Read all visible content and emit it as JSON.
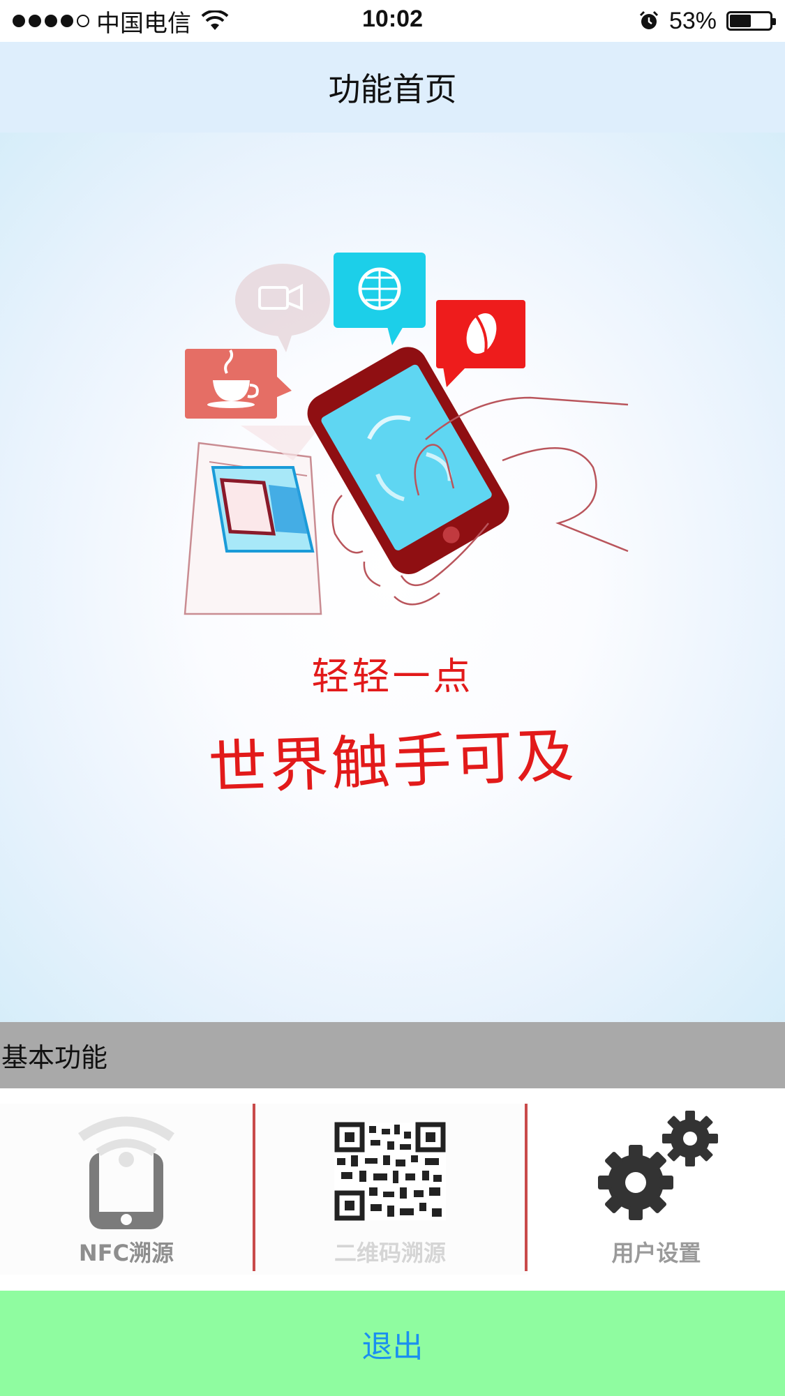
{
  "status_bar": {
    "carrier": "中国电信",
    "time": "10:02",
    "battery_percent": "53%",
    "battery_level": 0.53,
    "signal_bars_filled": 4,
    "signal_bars_total": 5
  },
  "nav": {
    "title": "功能首页"
  },
  "banner": {
    "slogan_line1": "轻轻一点",
    "slogan_line2": "世界触手可及"
  },
  "section": {
    "title": "基本功能"
  },
  "functions": [
    {
      "label": "NFC溯源",
      "icon": "nfc-phone-icon"
    },
    {
      "label": "二维码溯源",
      "icon": "qr-code-icon"
    },
    {
      "label": "用户设置",
      "icon": "gears-icon"
    }
  ],
  "exit": {
    "label": "退出"
  },
  "colors": {
    "nav_bg": "#deeefc",
    "section_bg": "#a9a9a9",
    "exit_bg": "#8ffca0",
    "exit_text": "#1a8ff0",
    "slogan": "#e21a1a",
    "divider": "#c94a4a"
  }
}
